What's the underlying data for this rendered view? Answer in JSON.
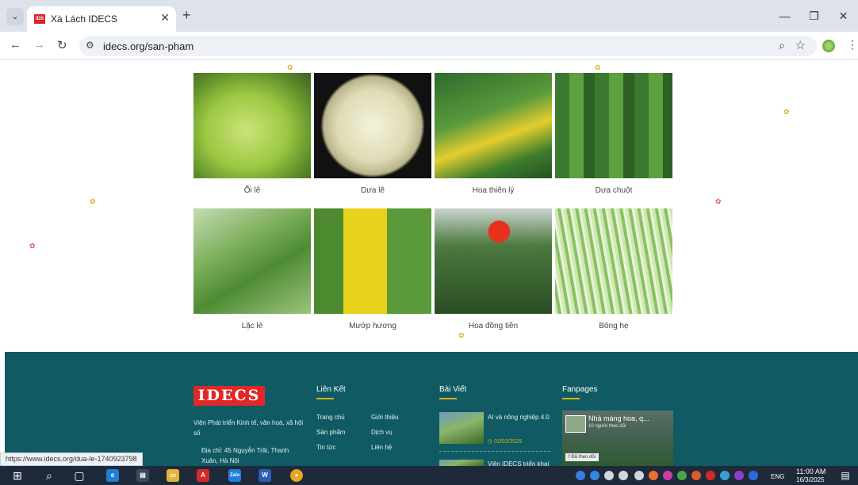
{
  "browser": {
    "tab_title": "Xà Lách IDECS",
    "tab_favicon": "IDS",
    "new_tab": "+",
    "url": "idecs.org/san-pham",
    "status_url": "https://www.idecs.org/dua-le-1740923798"
  },
  "products": [
    {
      "name": "Ổi lê"
    },
    {
      "name": "Dưa lê"
    },
    {
      "name": "Hoa thiên lý"
    },
    {
      "name": "Dưa chuột"
    },
    {
      "name": "Lặc lè"
    },
    {
      "name": "Mướp hương"
    },
    {
      "name": "Hoa đồng tiền"
    },
    {
      "name": "Bông hẹ"
    }
  ],
  "footer": {
    "logo_text": "IDECS",
    "org_name": "Viện Phát triển Kinh tế, văn hoá, xã hội số",
    "address": "Địa chỉ: 45 Nguyễn Trãi, Thanh Xuân, Hà Nội",
    "links_heading": "Liên Kết",
    "links": [
      "Trang chủ",
      "Giới thiệu",
      "Sản phẩm",
      "Dịch vụ",
      "Tin tức",
      "Liên hệ"
    ],
    "posts_heading": "Bài Viết",
    "posts": [
      {
        "title": "AI và nông nghiệp 4.0",
        "date": "02/03/2025"
      },
      {
        "title": "Viện IDECS triển khai"
      }
    ],
    "fanpages_heading": "Fanpages",
    "fanpage": {
      "title": "Nhà màng hoa, q...",
      "followers": "10 người theo dõi",
      "follow_label": "Đã theo dõi"
    }
  },
  "taskbar": {
    "language": "ENG",
    "time": "11:00 AM",
    "date": "16/3/2025",
    "zalo_label": "Zalo"
  },
  "colors": {
    "footer_bg": "#0f5a63",
    "accent_gold": "#d8b21c",
    "logo_red": "#e02827"
  }
}
